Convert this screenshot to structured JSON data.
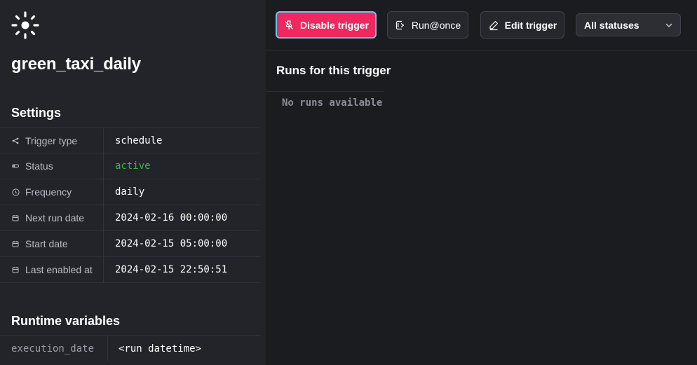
{
  "trigger": {
    "name": "green_taxi_daily"
  },
  "settings": {
    "title": "Settings",
    "rows": [
      {
        "label": "Trigger type",
        "value": "schedule",
        "icon": "share-icon"
      },
      {
        "label": "Status",
        "value": "active",
        "icon": "toggle-icon"
      },
      {
        "label": "Frequency",
        "value": "daily",
        "icon": "clock-icon"
      },
      {
        "label": "Next run date",
        "value": "2024-02-16 00:00:00",
        "icon": "calendar-icon"
      },
      {
        "label": "Start date",
        "value": "2024-02-15 05:00:00",
        "icon": "calendar-icon"
      },
      {
        "label": "Last enabled at",
        "value": "2024-02-15 22:50:51",
        "icon": "calendar-icon"
      }
    ]
  },
  "runtime": {
    "title": "Runtime variables",
    "rows": [
      {
        "key": "execution_date",
        "value": "<run datetime>"
      }
    ]
  },
  "toolbar": {
    "disable_label": "Disable trigger",
    "run_once_label": "Run@once",
    "edit_label": "Edit trigger",
    "status_filter": "All statuses"
  },
  "runs": {
    "title": "Runs for this trigger",
    "empty_text": "No runs available"
  },
  "colors": {
    "accent_pink": "#f0285f",
    "focus_ring": "#6cc6f0",
    "status_active": "#2fb84a"
  }
}
